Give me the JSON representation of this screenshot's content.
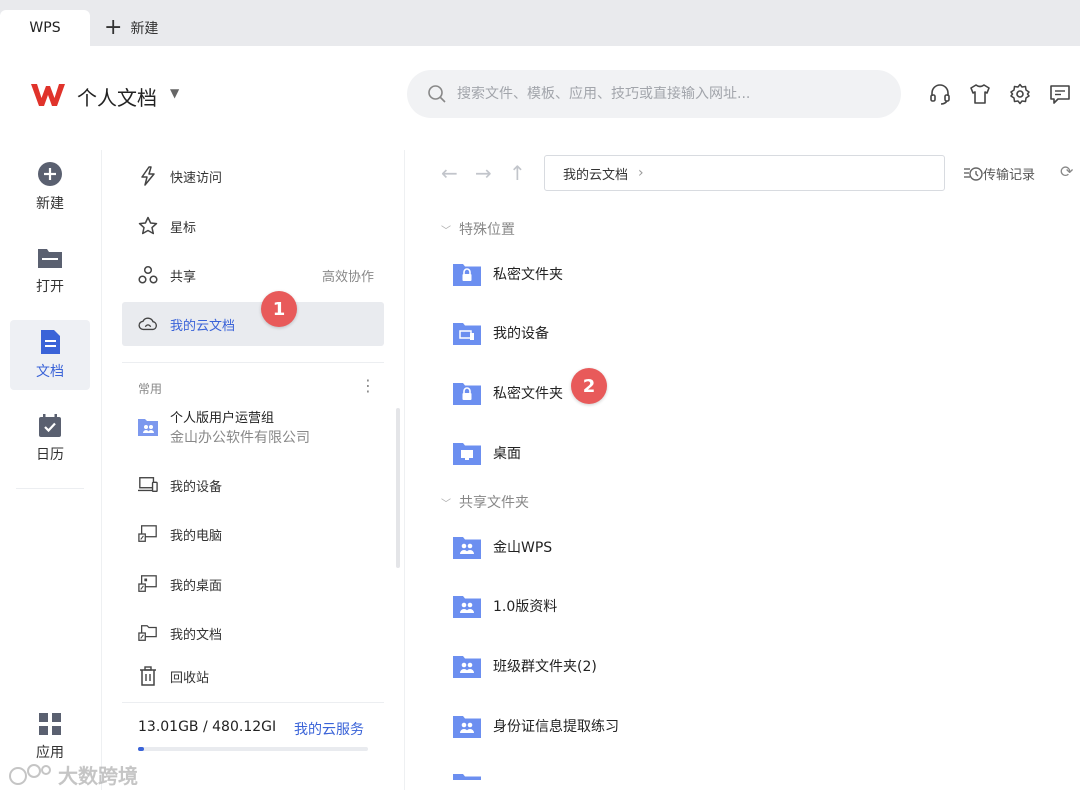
{
  "tabs": {
    "active": "WPS",
    "new_tab": "新建"
  },
  "header": {
    "title": "个人文档",
    "search_placeholder": "搜索文件、模板、应用、技巧或直接输入网址..."
  },
  "rail": {
    "items": [
      {
        "label": "新建"
      },
      {
        "label": "打开"
      },
      {
        "label": "文档"
      },
      {
        "label": "日历"
      }
    ],
    "apps": "应用"
  },
  "nav": {
    "items": [
      {
        "label": "快速访问"
      },
      {
        "label": "星标"
      },
      {
        "label": "共享",
        "extra": "高效协作"
      },
      {
        "label": "我的云文档"
      }
    ],
    "common_label": "常用",
    "org": {
      "name": "个人版用户运营组",
      "company": "金山办公软件有限公司"
    },
    "places": [
      {
        "label": "我的设备"
      },
      {
        "label": "我的电脑"
      },
      {
        "label": "我的桌面"
      },
      {
        "label": "我的文档"
      },
      {
        "label": "回收站"
      }
    ],
    "storage": "13.01GB / 480.12GI",
    "storage_link": "我的云服务",
    "storage_used_fraction": 0.027
  },
  "main": {
    "path": "我的云文档",
    "transfer": "传输记录",
    "groups": [
      {
        "title": "特殊位置",
        "folders": [
          {
            "label": "私密文件夹",
            "icon": "lock-folder-icon"
          },
          {
            "label": "我的设备",
            "icon": "device-folder-icon"
          },
          {
            "label": "私密文件夹",
            "icon": "lock-folder-icon"
          },
          {
            "label": "桌面",
            "icon": "desktop-folder-icon"
          }
        ]
      },
      {
        "title": "共享文件夹",
        "folders": [
          {
            "label": "金山WPS",
            "icon": "shared-folder-icon"
          },
          {
            "label": "1.0版资料",
            "icon": "shared-folder-icon"
          },
          {
            "label": "班级群文件夹(2)",
            "icon": "shared-folder-icon"
          },
          {
            "label": "身份证信息提取练习",
            "icon": "shared-folder-icon"
          }
        ]
      }
    ]
  },
  "badges": {
    "one": "1",
    "two": "2"
  },
  "watermark": "大数跨境",
  "colors": {
    "accent": "#3a63d8",
    "folder": "#6c8ff0",
    "badge": "#e85a5a",
    "logo": "#e0332b"
  }
}
